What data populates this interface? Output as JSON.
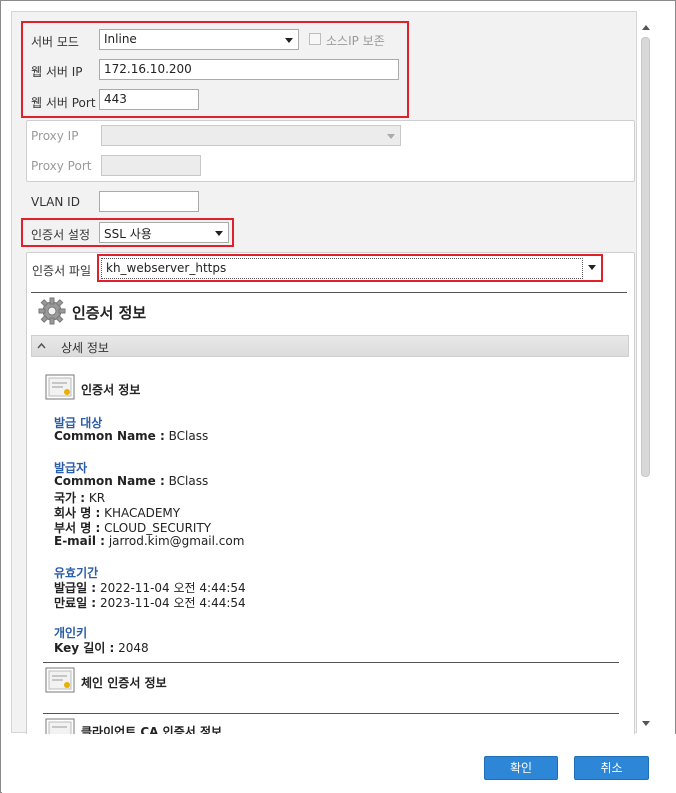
{
  "form": {
    "server_mode_label": "서버 모드",
    "server_mode_value": "Inline",
    "source_ip_keep_label": "소스IP 보존",
    "web_server_ip_label": "웹 서버 IP",
    "web_server_ip_value": "172.16.10.200",
    "web_server_port_label": "웹 서버 Port",
    "web_server_port_value": "443",
    "proxy_ip_label": "Proxy IP",
    "proxy_ip_value": "",
    "proxy_port_label": "Proxy Port",
    "proxy_port_value": "",
    "vlan_id_label": "VLAN ID",
    "vlan_id_value": "",
    "cert_setting_label": "인증서 설정",
    "cert_setting_value": "SSL 사용",
    "cert_file_label": "인증서 파일",
    "cert_file_value": "kh_webserver_https"
  },
  "cert_info": {
    "header": "인증서 정보",
    "detail_section": "상세 정보",
    "cert_title": "인증서 정보",
    "issued_to_label": "발급 대상",
    "issued_to_cn_key": "Common Name :",
    "issued_to_cn_val": "BClass",
    "issuer_label": "발급자",
    "issuer_cn_key": "Common Name :",
    "issuer_cn_val": "BClass",
    "country_key": "국가 :",
    "country_val": "KR",
    "org_key": "회사 명 :",
    "org_val": "KHACADEMY",
    "dept_key": "부서 명 :",
    "dept_val": "CLOUD_SECURITY",
    "email_key": "E-mail :",
    "email_val": "jarrod.kim@gmail.com",
    "validity_label": "유효기간",
    "issued_date_key": "발급일 :",
    "issued_date_val": "2022-11-04 오전 4:44:54",
    "expire_date_key": "만료일 :",
    "expire_date_val": "2023-11-04 오전 4:44:54",
    "private_key_label": "개인키",
    "key_length_key": "Key 길이 :",
    "key_length_val": "2048",
    "chain_cert_title": "체인 인증서 정보",
    "client_ca_title": "클라이언트 CA 인증서 정보"
  },
  "buttons": {
    "ok": "확인",
    "cancel": "취소"
  },
  "colors": {
    "highlight_red": "#e0202a",
    "primary_button": "#2d86d6",
    "category_blue": "#2a5da8"
  }
}
